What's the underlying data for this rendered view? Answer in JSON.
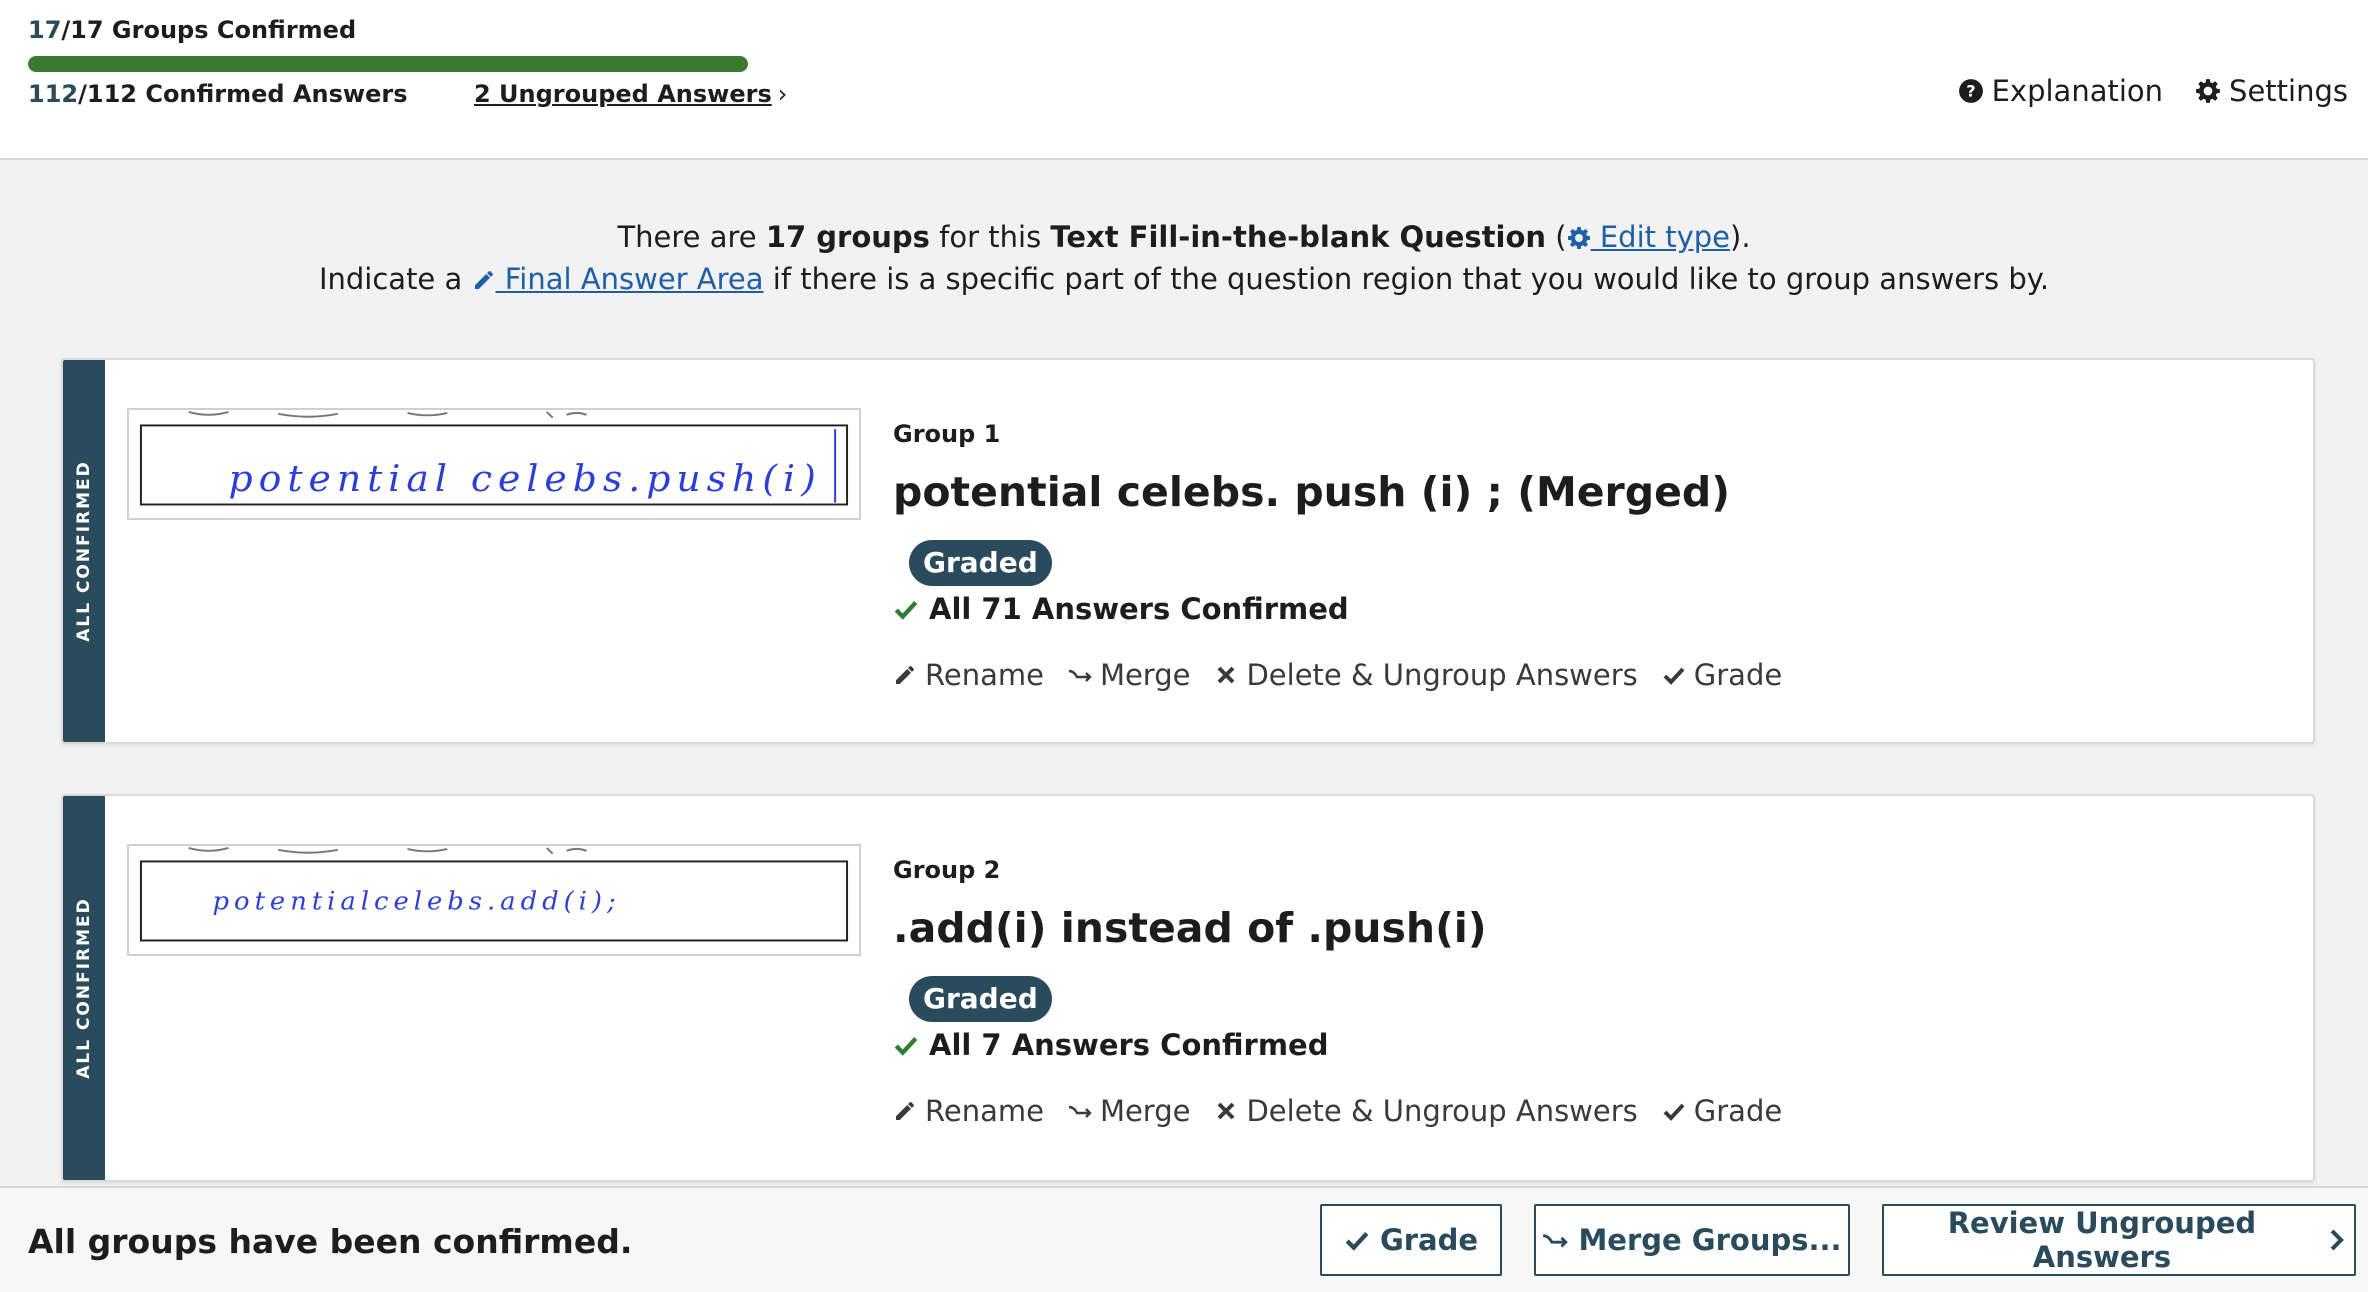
{
  "header": {
    "groups_confirmed_num": "17",
    "groups_confirmed_rest": "/17 Groups Confirmed",
    "progress_fraction": 1.0,
    "answers_confirmed_num": "112",
    "answers_confirmed_rest": "/112 Confirmed Answers",
    "ungrouped_link": "2 Ungrouped Answers",
    "explanation_label": "Explanation",
    "settings_label": "Settings"
  },
  "intro": {
    "line1_a": "There are ",
    "line1_bold_count": "17 groups",
    "line1_b": " for this ",
    "line1_bold_type": "Text Fill-in-the-blank Question",
    "line1_c": " (",
    "edit_type_link": " Edit type",
    "line1_d": ").",
    "line2_a": "Indicate a ",
    "final_answer_link": " Final Answer Area",
    "line2_b": " if there is a specific part of the question region that you would like to group answers by."
  },
  "groups": [
    {
      "status": "ALL CONFIRMED",
      "label": "Group 1",
      "title": "potential celebs. push (i) ; (Merged)",
      "badge": "Graded",
      "confirmed_text": "All 71 Answers Confirmed",
      "handwriting": "potential celebs.push(i)"
    },
    {
      "status": "ALL CONFIRMED",
      "label": "Group 2",
      "title": ".add(i) instead of .push(i)",
      "badge": "Graded",
      "confirmed_text": "All 7 Answers Confirmed",
      "handwriting": "potentialcelebs.add(i);"
    }
  ],
  "actions": {
    "rename": "Rename",
    "merge": "Merge",
    "delete": "Delete & Ungroup Answers",
    "grade": "Grade"
  },
  "footer": {
    "message": "All groups have been confirmed.",
    "grade_button": "Grade",
    "merge_groups_button": "Merge Groups...",
    "review_button": "Review Ungrouped Answers"
  },
  "colors": {
    "accent": "#2a4b5b",
    "progress": "#3b7a2e",
    "link": "#1e5fa8",
    "check": "#2e7d32",
    "handwriting_ink": "#2b3fd6"
  }
}
